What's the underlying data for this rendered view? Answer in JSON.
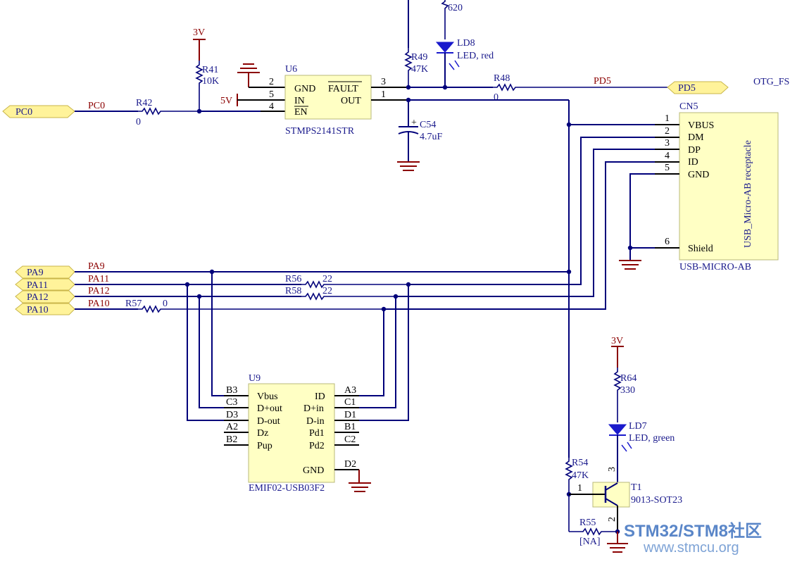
{
  "ports": {
    "pc0": "PC0",
    "pd5": "PD5",
    "pa9": "PA9",
    "pa11": "PA11",
    "pa12": "PA12",
    "pa10": "PA10"
  },
  "nets": {
    "pc0": "PC0",
    "pd5": "PD5",
    "otg": "OTG_FS",
    "pa9": "PA9",
    "pa11": "PA11",
    "pa12": "PA12",
    "pa10": "PA10"
  },
  "power": {
    "v3_a": "3V",
    "v3_b": "3V",
    "v5": "5V"
  },
  "resistors": {
    "r41": {
      "ref": "R41",
      "value": "10K"
    },
    "r42": {
      "ref": "R42",
      "value": "0"
    },
    "r48": {
      "ref": "R48",
      "value": "0"
    },
    "r49": {
      "ref": "R49",
      "value": "47K"
    },
    "r_led8": {
      "value": "620"
    },
    "r54": {
      "ref": "R54",
      "value": "47K"
    },
    "r55": {
      "ref": "R55",
      "value": "[NA]"
    },
    "r56": {
      "ref": "R56",
      "value": "22"
    },
    "r57": {
      "ref": "R57",
      "value": "0"
    },
    "r58": {
      "ref": "R58",
      "value": "22"
    },
    "r64": {
      "ref": "R64",
      "value": "330"
    }
  },
  "capacitor": {
    "ref": "C54",
    "value": "4.7uF"
  },
  "leds": {
    "ld8": {
      "ref": "LD8",
      "value": "LED, red"
    },
    "ld7": {
      "ref": "LD7",
      "value": "LED, green"
    }
  },
  "u6": {
    "ref": "U6",
    "part": "STMPS2141STR",
    "pins": {
      "gnd": "GND",
      "in": "IN",
      "en": "EN",
      "fault": "FAULT",
      "out": "OUT"
    },
    "nums": {
      "p2": "2",
      "p5": "5",
      "p4": "4",
      "p3": "3",
      "p1": "1"
    }
  },
  "cn5": {
    "ref": "CN5",
    "part": "USB-MICRO-AB",
    "title": "USB_Micro-AB receptacle",
    "pins": [
      "VBUS",
      "DM",
      "DP",
      "ID",
      "GND",
      "Shield"
    ],
    "nums": [
      "1",
      "2",
      "3",
      "4",
      "5",
      "6"
    ]
  },
  "u9": {
    "ref": "U9",
    "part": "EMIF02-USB03F2",
    "left": [
      "Vbus",
      "D+out",
      "D-out",
      "Dz",
      "Pup"
    ],
    "left_nums": [
      "B3",
      "C3",
      "D3",
      "A2",
      "B2"
    ],
    "right": [
      "ID",
      "D+in",
      "D-in",
      "Pd1",
      "Pd2",
      "GND"
    ],
    "right_nums": [
      "A3",
      "C1",
      "D1",
      "B1",
      "C2",
      "D2"
    ]
  },
  "t1": {
    "ref": "T1",
    "part": "9013-SOT23",
    "p1": "1",
    "p2": "2",
    "p3": "3"
  },
  "watermark": {
    "brand": "STM32/STM8社区",
    "url": "www.stmcu.org"
  }
}
